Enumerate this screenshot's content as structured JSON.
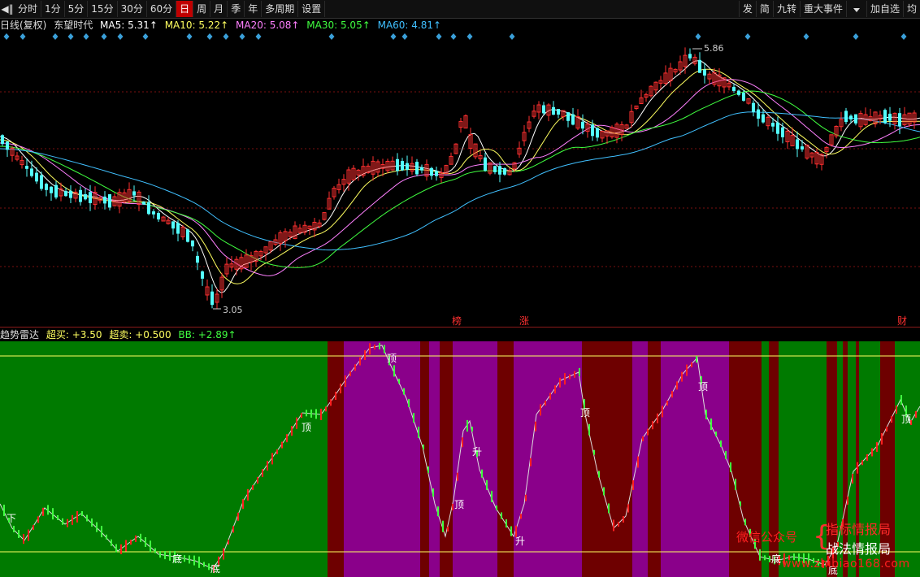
{
  "toolbar": {
    "periods": [
      "分时",
      "1分",
      "5分",
      "15分",
      "30分",
      "60分",
      "日",
      "周",
      "月",
      "季",
      "年",
      "多周期",
      "设置"
    ],
    "active": "日",
    "right": [
      "发",
      "简",
      "九转",
      "重大事件",
      "加自选",
      "均"
    ]
  },
  "legend_main": {
    "kline": "日线(复权)",
    "stock": "东望时代",
    "ma5": "MA5: 5.31↑",
    "ma10": "MA10: 5.22↑",
    "ma20": "MA20: 5.08↑",
    "ma30": "MA30: 5.05↑",
    "ma60": "MA60: 4.81↑"
  },
  "legend_ind": {
    "name": "趋势雷达",
    "buy": "超买: +3.50",
    "sell": "超卖: +0.500",
    "bb": "BB: +2.89↑"
  },
  "colors": {
    "up": "#ff3030",
    "down": "#54ffff",
    "ma5": "#ffffff",
    "ma10": "#ffff60",
    "ma20": "#ff80ff",
    "ma30": "#40ff40",
    "ma60": "#40c0ff",
    "band_green": "#007a00",
    "band_purple": "#8a008a",
    "band_red": "#6e0000",
    "diamond": "#3a9fd8"
  },
  "watermark": {
    "left": "微信公众号",
    "right1": "指标情报局",
    "right2": "战法情报局",
    "url": "www.zhibiao168.com"
  },
  "chart_data": [
    {
      "type": "candlestick",
      "title": "",
      "ylim": [
        2.9,
        6.1
      ],
      "annotations": [
        {
          "label": "5.86",
          "value": 5.86
        },
        {
          "label": "3.05",
          "value": 3.05
        }
      ],
      "markers": [
        "榜",
        "涨",
        "财"
      ],
      "series": [
        {
          "name": "MA5",
          "value": 5.31
        },
        {
          "name": "MA10",
          "value": 5.22
        },
        {
          "name": "MA20",
          "value": 5.08
        },
        {
          "name": "MA30",
          "value": 5.05
        },
        {
          "name": "MA60",
          "value": 4.81
        }
      ]
    },
    {
      "type": "bar",
      "title": "",
      "thresholds": {
        "buy": 3.5,
        "sell": 0.5
      },
      "series": [
        {
          "name": "BB",
          "value": 2.89
        }
      ],
      "labels": [
        "下",
        "底",
        "底",
        "顶",
        "顶",
        "升",
        "顶",
        "升",
        "顶",
        "顶",
        "顶",
        "底",
        "底"
      ]
    }
  ]
}
